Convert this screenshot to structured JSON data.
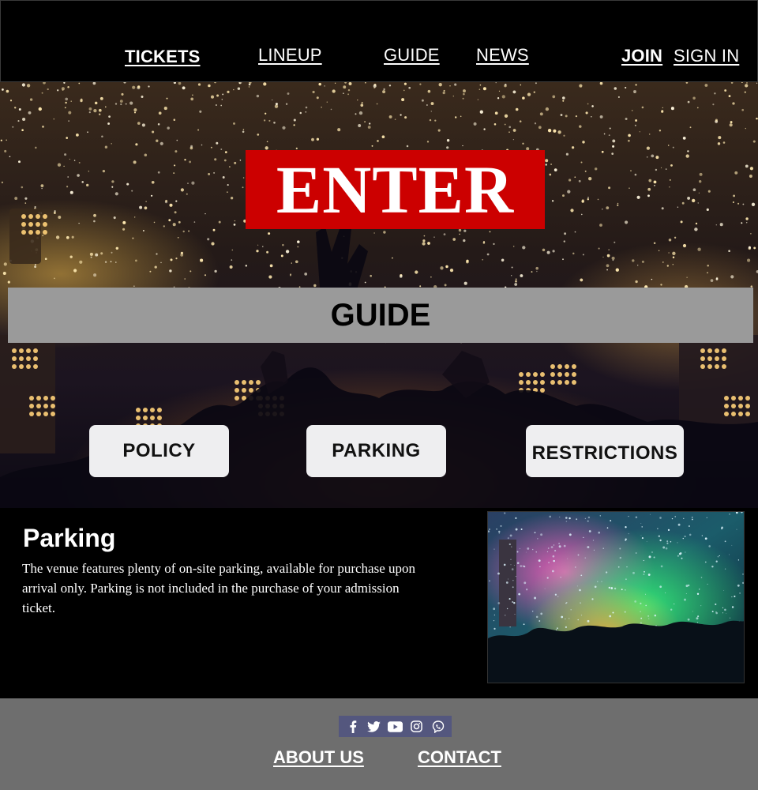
{
  "nav": {
    "links": [
      "TICKETS",
      "LINEUP",
      "GUIDE",
      "NEWS"
    ],
    "join": "JOIN",
    "sign_in": "SIGN IN"
  },
  "hero": {
    "logo_text": "ENTER",
    "banner_title": "GUIDE",
    "buttons": [
      "POLICY",
      "PARKING",
      "RESTRICTIONS"
    ],
    "colors": {
      "logo_bg": "#cc0000",
      "banner_bg": "#9a9a9a",
      "button_bg": "#eeeef0"
    }
  },
  "content": {
    "heading": "Parking",
    "body": "The venue features plenty of on-site parking, available for purchase upon arrival only. Parking is not included in the purchase of your admission ticket.",
    "photo_icon": "concert-photo"
  },
  "footer": {
    "social_icons": [
      "facebook-icon",
      "twitter-icon",
      "youtube-icon",
      "instagram-icon",
      "viber-icon"
    ],
    "links": [
      "ABOUT US",
      "CONTACT"
    ],
    "colors": {
      "bg": "#6e6e6e",
      "social_bg": "#54577e"
    }
  }
}
